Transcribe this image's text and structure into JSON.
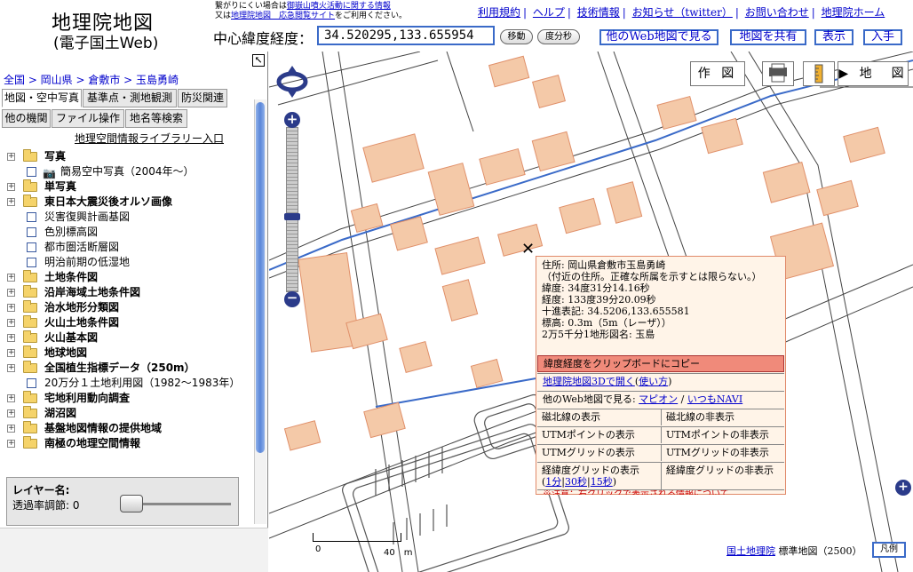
{
  "header": {
    "logo_line1": "地理院地図",
    "logo_line2": "(電子国土Web)",
    "notice_prefix": "繋がりにくい場合は",
    "notice_link1": "御嶽山噴火活動に関する情報",
    "notice_line2_prefix": "又は",
    "notice_link2": "地理院地図　応急閲覧サイト",
    "notice_suffix": "をご利用ください。",
    "nav": [
      "利用規約",
      "ヘルプ",
      "技術情報",
      "お知らせ（twitter）",
      "お問い合わせ",
      "地理院ホーム"
    ],
    "center_label": "中心緯度経度：",
    "coord_value": "34.520295,133.655954",
    "move_button": "移動",
    "dms_button": "度分秒",
    "other_maps_button": "他のWeb地図で見る",
    "share_button": "地図を共有",
    "display_button": "表示",
    "get_button": "入手"
  },
  "left_panel": {
    "breadcrumb": "全国 > 岡山県 > 倉敷市 > 玉島勇崎",
    "tabs_row1": [
      "地図・空中写真",
      "基準点・測地観測",
      "防災関連"
    ],
    "tabs_row2": [
      "他の機関",
      "ファイル操作",
      "地名等検索"
    ],
    "library_link": "地理空間情報ライブラリー入口",
    "tree": [
      {
        "type": "folder",
        "label": "写真",
        "bold": true
      },
      {
        "type": "photo",
        "label": "簡易空中写真（2004年〜）"
      },
      {
        "type": "folder",
        "label": "単写真",
        "bold": true
      },
      {
        "type": "folder",
        "label": "東日本大震災後オルソ画像",
        "bold": true
      },
      {
        "type": "leaf",
        "label": "災害復興計画基図"
      },
      {
        "type": "leaf",
        "label": "色別標高図"
      },
      {
        "type": "leaf",
        "label": "都市圏活断層図"
      },
      {
        "type": "leaf",
        "label": "明治前期の低湿地"
      },
      {
        "type": "folder",
        "label": "土地条件図",
        "bold": true
      },
      {
        "type": "folder",
        "label": "沿岸海域土地条件図",
        "bold": true
      },
      {
        "type": "folder",
        "label": "治水地形分類図",
        "bold": true
      },
      {
        "type": "folder",
        "label": "火山土地条件図",
        "bold": true
      },
      {
        "type": "folder",
        "label": "火山基本図",
        "bold": true
      },
      {
        "type": "folder",
        "label": "地球地図",
        "bold": true
      },
      {
        "type": "folder",
        "label": "全国植生指標データ（250m）",
        "bold": true
      },
      {
        "type": "leaf",
        "label": "20万分１土地利用図（1982〜1983年）"
      },
      {
        "type": "folder",
        "label": "宅地利用動向調査",
        "bold": true
      },
      {
        "type": "folder",
        "label": "湖沼図",
        "bold": true
      },
      {
        "type": "folder",
        "label": "基盤地図情報の提供地域",
        "bold": true
      },
      {
        "type": "folder",
        "label": "南極の地理空間情報",
        "bold": true
      }
    ],
    "layer_name_label": "レイヤー名:",
    "opacity_label": "透過率調節: 0"
  },
  "map": {
    "sakuzu_button": "作 図",
    "chizu_button": "▶ 地　図",
    "popup": {
      "address": "住所: 岡山県倉敷市玉島勇崎",
      "address_note": "（付近の住所。正確な所属を示すとは限らない。）",
      "lat": "緯度: 34度31分14.16秒",
      "lon": "経度: 133度39分20.09秒",
      "decimal": "十進表記: 34.5206,133.655581",
      "elevation": "標高: 0.3m（5m（レーザ））",
      "sheet": "2万5千分1地形図名: 玉島",
      "copy_button": "緯度経度をクリップボードにコピー",
      "open_3d": "地理院地図3Dで開く",
      "howto": "使い方",
      "other_prefix": "他のWeb地図で見る: ",
      "mapion": "マピオン",
      "itsumo": "いつもNAVI",
      "mag_show": "磁北線の表示",
      "mag_hide": "磁北線の非表示",
      "utm_pt_show": "UTMポイントの表示",
      "utm_pt_hide": "UTMポイントの非表示",
      "utm_grid_show": "UTMグリッドの表示",
      "utm_grid_hide": "UTMグリッドの非表示",
      "latlon_grid_show": "経緯度グリッドの表示",
      "grid_1": "1分",
      "grid_30": "30秒",
      "grid_15": "15秒",
      "latlon_grid_hide": "経緯度グリッドの非表示",
      "cutoff_note": "※注意：右クリックで表示される情報について"
    },
    "scale_zero": "0",
    "scale_forty": "40　m",
    "attribution_org": "国土地理院",
    "attribution_text": " 標準地図（2500）",
    "legend_button": "凡例",
    "crosshair": "✕"
  }
}
